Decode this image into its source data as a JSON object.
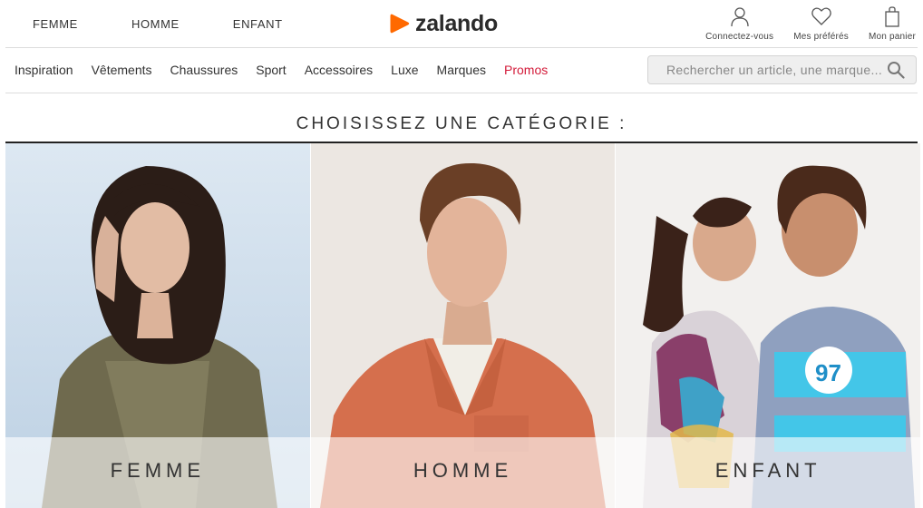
{
  "gender_tabs": [
    "FEMME",
    "HOMME",
    "ENFANT"
  ],
  "logo": {
    "text": "zalando",
    "brand_color": "#ff6900"
  },
  "account": {
    "login_label": "Connectez-vous",
    "favorites_label": "Mes préférés",
    "cart_label": "Mon panier",
    "icons": [
      "user-icon",
      "heart-icon",
      "shopping-bag-icon"
    ]
  },
  "category_nav": {
    "items": [
      "Inspiration",
      "Vêtements",
      "Chaussures",
      "Sport",
      "Accessoires",
      "Luxe",
      "Marques",
      "Promos"
    ],
    "promo_color": "#d31b3a"
  },
  "search": {
    "placeholder": "Rechercher un article, une marque..."
  },
  "heading": "CHOISISSEZ UNE CATÉGORIE :",
  "category_tiles": [
    {
      "label": "FEMME"
    },
    {
      "label": "HOMME"
    },
    {
      "label": "ENFANT"
    }
  ]
}
